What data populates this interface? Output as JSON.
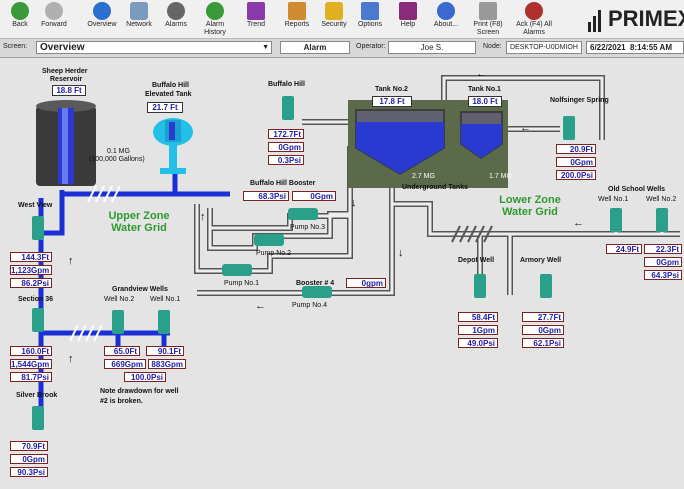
{
  "toolbar": {
    "buttons": [
      {
        "label": "Back",
        "icon": "back-arrow-icon",
        "color": "#3a9a3a"
      },
      {
        "label": "Forward",
        "icon": "forward-arrow-icon",
        "color": "#9a9a9a"
      },
      {
        "label": "Overview",
        "icon": "globe-icon",
        "color": "#2b6fd0"
      },
      {
        "label": "Network",
        "icon": "network-icon",
        "color": "#6a8ab0"
      },
      {
        "label": "Alarms",
        "icon": "alarm-icon",
        "color": "#555"
      },
      {
        "label": "Alarm History",
        "icon": "alarm-history-icon",
        "color": "#3a9a3a"
      },
      {
        "label": "Trend",
        "icon": "trend-icon",
        "color": "#8a3aa8"
      },
      {
        "label": "Reports",
        "icon": "reports-icon",
        "color": "#d08a30"
      },
      {
        "label": "Security",
        "icon": "lock-icon",
        "color": "#e0b020"
      },
      {
        "label": "Options",
        "icon": "options-icon",
        "color": "#4a7ad0"
      },
      {
        "label": "Help",
        "icon": "help-book-icon",
        "color": "#8a2a7a"
      },
      {
        "label": "About...",
        "icon": "info-icon",
        "color": "#3a6ad0"
      },
      {
        "label": "Print (F8) Screen",
        "icon": "print-icon",
        "color": "#888"
      },
      {
        "label": "Ack (F4) All Alarms",
        "icon": "ack-alarms-icon",
        "color": "#b03030"
      }
    ],
    "logo_text": "PRIMEX"
  },
  "status": {
    "screen_label": "Screen:",
    "screen_value": "Overview",
    "alarm_label": "Alarm",
    "operator_label": "Operator:",
    "operator_value": "Joe S.",
    "node_label": "Node:",
    "node_value": "DESKTOP-U0DMIOH",
    "date": "6/22/2021",
    "time": "8:14:55 AM"
  },
  "diagram": {
    "sheep_herder": {
      "title1": "Sheep Herder",
      "title2": "Reservoir",
      "level": "18.8 Ft"
    },
    "buffalo_hill_tank": {
      "title1": "Buffalo Hill",
      "title2": "Elevated Tank",
      "level": "21.7 Ft",
      "capacity1": "0.1 MG",
      "capacity2": "(100,000 Gallons)"
    },
    "buffalo_hill_well": {
      "title": "Buffalo Hill",
      "level": "172.7Ft",
      "flow": "0Gpm",
      "pressure": "0.3Psi"
    },
    "tank2": {
      "title": "Tank No.2",
      "level": "17.8 Ft",
      "capacity": "2.7 MG"
    },
    "tank1": {
      "title": "Tank No.1",
      "level": "18.0 Ft",
      "capacity": "1.7 MG"
    },
    "underground_label": "Underground Tanks",
    "nolfsinger": {
      "title": "Nolfsinger Spring",
      "level": "20.9Ft",
      "flow": "0Gpm",
      "pressure": "200.0Psi"
    },
    "booster": {
      "title": "Buffalo Hill Booster",
      "pressure": "68.3Psi",
      "flow": "0Gpm"
    },
    "pumps": {
      "p3": "Pump No.3",
      "p2": "Pump No.2",
      "p1": "Pump No.1",
      "p4": "Pump No.4"
    },
    "booster4": {
      "title": "Booster # 4",
      "flow": "0gpm"
    },
    "upper_zone": {
      "line1": "Upper Zone",
      "line2": "Water Grid"
    },
    "lower_zone": {
      "line1": "Lower Zone",
      "line2": "Water Grid"
    },
    "old_school": {
      "title": "Old School Wells",
      "w1": "Well No.1",
      "w2": "Well No.2",
      "w1_level": "24.9Ft",
      "w2_level": "22.3Ft",
      "flow": "0Gpm",
      "pressure": "64.3Psi"
    },
    "west_view": {
      "title": "West View",
      "level": "144.3Ft",
      "flow": "1,123Gpm",
      "pressure": "86.2Psi"
    },
    "section36": {
      "title": "Section 36",
      "level": "160.0Ft",
      "flow": "1,544Gpm",
      "pressure": "81.7Psi"
    },
    "grandview": {
      "title": "Grandview Wells",
      "w2": "Well No.2",
      "w1": "Well No.1",
      "w2_level": "65.0Ft",
      "w1_level": "90.1Ft",
      "w2_flow": "669Gpm",
      "w1_flow": "883Gpm",
      "pressure": "100.0Psi",
      "note1": "Note drawdown for well",
      "note2": "#2 is broken."
    },
    "silver_brook": {
      "title": "Silver Brook",
      "level": "70.9Ft",
      "flow": "0Gpm",
      "pressure": "90.3Psi"
    },
    "depot": {
      "title": "Depot Well",
      "level": "58.4Ft",
      "flow": "1Gpm",
      "pressure": "49.0Psi"
    },
    "armory": {
      "title": "Armory Well",
      "level": "27.7Ft",
      "flow": "0Gpm",
      "pressure": "62.1Psi"
    },
    "colors": {
      "pipe_blue": "#1a2fd6",
      "pipe_gray": "#e2e2e2",
      "pump_green": "#2aa08a",
      "water": "#2a3ad0",
      "zone_green": "#2e9a2e"
    }
  }
}
